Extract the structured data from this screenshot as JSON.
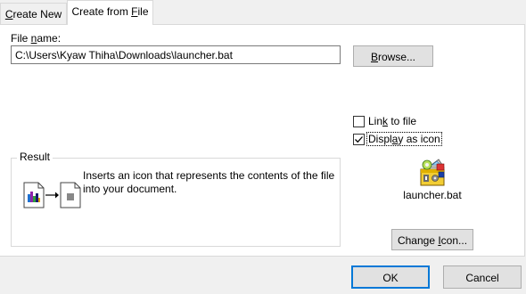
{
  "tabs": [
    {
      "mnemonic": "C",
      "rest": "reate New",
      "selected": false
    },
    {
      "prefix": "Create from ",
      "mnemonic": "F",
      "rest": "ile",
      "selected": true
    }
  ],
  "file_name": {
    "label_prefix": "File ",
    "label_mnemonic": "n",
    "label_rest": "ame:",
    "value": "C:\\Users\\Kyaw Thiha\\Downloads\\launcher.bat"
  },
  "browse_button": {
    "mnemonic": "B",
    "rest": "rowse..."
  },
  "link_to_file": {
    "prefix": "Lin",
    "mnemonic": "k",
    "rest": " to file",
    "checked": false
  },
  "display_as_icon": {
    "prefix": "Displ",
    "mnemonic": "a",
    "rest": "y as icon",
    "checked": true
  },
  "result": {
    "title": "Result",
    "text": "Inserts an icon that represents the contents of the file into your document."
  },
  "icon_preview": {
    "icon": "batch-file-icon",
    "label": "launcher.bat"
  },
  "change_icon_button": {
    "prefix": "Change ",
    "mnemonic": "I",
    "rest": "con..."
  },
  "ok_button": {
    "label": "OK"
  },
  "cancel_button": {
    "label": "Cancel"
  },
  "colors": {
    "accent": "#0078d7",
    "panel": "#ffffff",
    "dialog": "#f0f0f0"
  }
}
